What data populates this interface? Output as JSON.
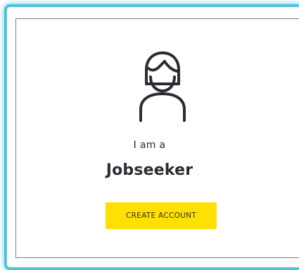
{
  "card": {
    "icon": "jobseeker-avatar-icon",
    "lead_text": "I am a",
    "role_title": "Jobseeker",
    "cta_label": "CREATE ACCOUNT"
  },
  "colors": {
    "accent_border": "#4fc3dc",
    "button": "#ffe000",
    "text_dark": "#2b2d33"
  }
}
